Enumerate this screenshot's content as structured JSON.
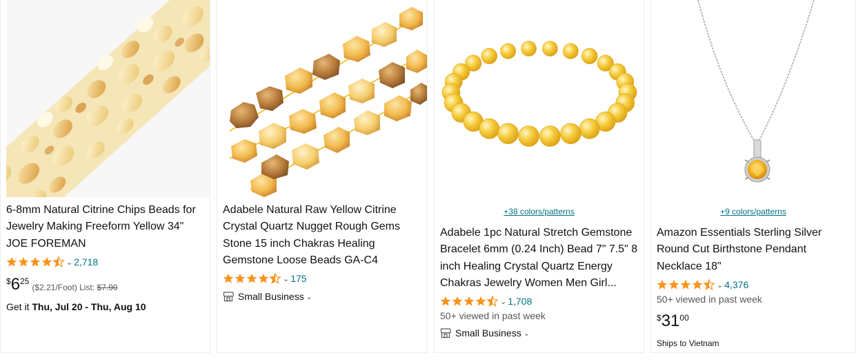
{
  "products": [
    {
      "title": "6-8mm Natural Citrine Chips Beads for Jewelry Making Freeform Yellow 34\" JOE FOREMAN",
      "rating_count": "2,718",
      "rating_value": 4.5,
      "price_symbol": "$",
      "price_whole": "6",
      "price_fraction": "25",
      "unit_price": "($2.21/Foot)",
      "list_label": "List:",
      "list_price": "$7.90",
      "delivery_prefix": "Get it",
      "delivery_dates": "Thu, Jul 20 - Thu, Aug 10"
    },
    {
      "title": "Adabele Natural Raw Yellow Citrine Crystal Quartz Nugget Rough Gems Stone 15 inch Chakras Healing Gemstone Loose Beads GA-C4",
      "rating_count": "175",
      "rating_value": 4.5,
      "badge": "Small Business"
    },
    {
      "colors_link": "+38 colors/patterns",
      "title": "Adabele 1pc Natural Stretch Gemstone Bracelet 6mm (0.24 Inch) Bead 7\" 7.5\" 8 inch Healing Crystal Quartz Energy Chakras Jewelry Women Men Girl...",
      "rating_count": "1,708",
      "rating_value": 4.5,
      "viewed": "50+ viewed in past week",
      "badge": "Small Business"
    },
    {
      "colors_link": "+9 colors/patterns",
      "title": "Amazon Essentials Sterling Silver Round Cut Birthstone Pendant Necklace 18\"",
      "rating_count": "4,376",
      "rating_value": 4.5,
      "viewed": "50+ viewed in past week",
      "price_symbol": "$",
      "price_whole": "31",
      "price_fraction": "00",
      "shipping": "Ships to Vietnam"
    }
  ],
  "colors": {
    "star": "#f7941d",
    "link": "#007185",
    "text": "#0f1111",
    "muted": "#565959",
    "citrine": "#f3c245"
  }
}
